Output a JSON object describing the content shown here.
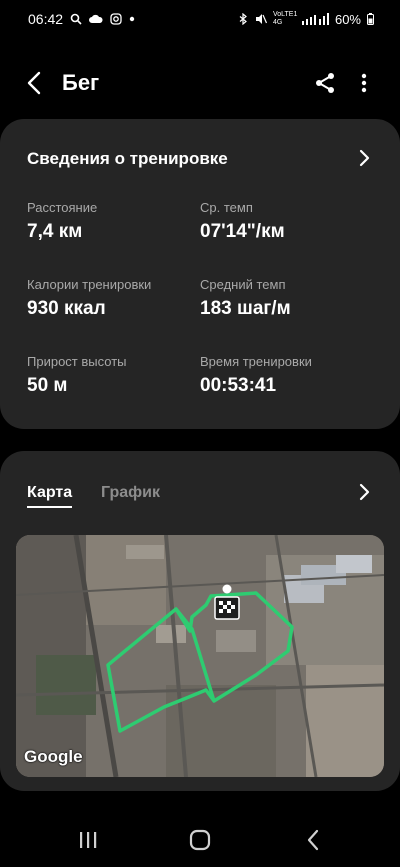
{
  "status_bar": {
    "time": "06:42",
    "network": "VoLTE1 4G",
    "battery": "60%",
    "icons": [
      "search-icon",
      "cloud-icon",
      "instagram-icon",
      "dot-icon",
      "bluetooth-icon",
      "mute-icon",
      "signal-icon",
      "battery-icon"
    ]
  },
  "app_bar": {
    "title": "Бег",
    "icons": [
      "back-arrow-icon",
      "share-icon",
      "more-vert-icon"
    ]
  },
  "workout": {
    "title": "Сведения о тренировке",
    "stats": [
      {
        "label": "Расстояние",
        "value": "7,4 км"
      },
      {
        "label": "Ср. темп",
        "value": "07'14\"/км"
      },
      {
        "label": "Калории тренировки",
        "value": "930 ккал"
      },
      {
        "label": "Средний темп",
        "value": "183 шаг/м"
      },
      {
        "label": "Прирост высоты",
        "value": "50 м"
      },
      {
        "label": "Время тренировки",
        "value": "00:53:41"
      }
    ]
  },
  "map_card": {
    "tabs": [
      "Карта",
      "График"
    ],
    "active_tab": "Карта",
    "map_attribution": "Google",
    "route_color": "#2ecc71",
    "icons": [
      "finish-flag-icon",
      "chevron-right-icon"
    ]
  },
  "nav_bar": {
    "icons": [
      "recents-icon",
      "home-icon",
      "back-icon"
    ]
  },
  "colors": {
    "background": "#000000",
    "card": "#252525",
    "label": "#a9a9a9",
    "route": "#2ecc71"
  }
}
